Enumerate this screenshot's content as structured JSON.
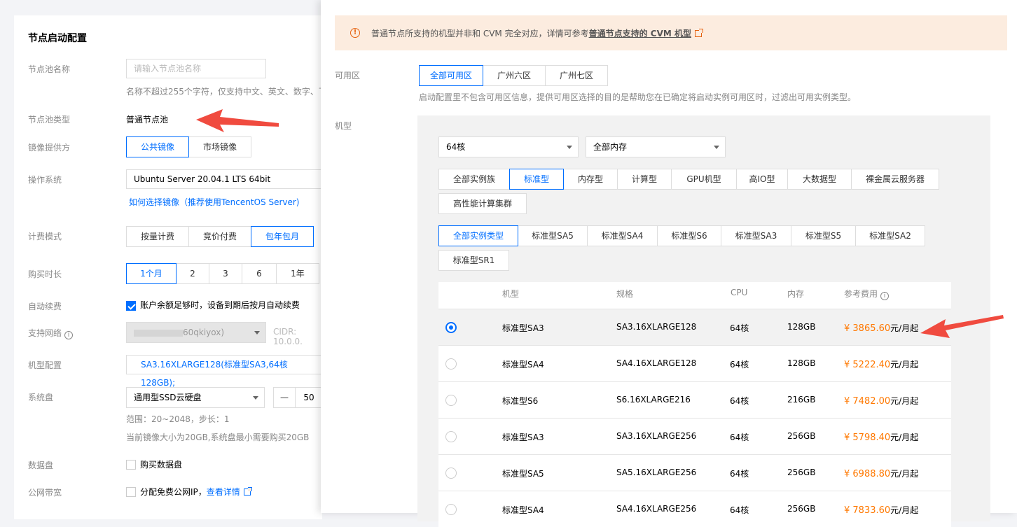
{
  "left": {
    "title": "节点启动配置",
    "pool_name": {
      "label": "节点池名称",
      "placeholder": "请输入节点池名称",
      "hint": "名称不超过255个字符，仅支持中文、英文、数字、下"
    },
    "pool_type": {
      "label": "节点池类型",
      "value": "普通节点池"
    },
    "image_provider": {
      "label": "镜像提供方",
      "options": [
        "公共镜像",
        "市场镜像"
      ]
    },
    "os": {
      "label": "操作系统",
      "value": "Ubuntu Server 20.04.1 LTS 64bit",
      "link": "如何选择镜像（推荐使用TencentOS Server)"
    },
    "billing": {
      "label": "计费模式",
      "options": [
        "按量计费",
        "竞价付费",
        "包年包月"
      ]
    },
    "duration": {
      "label": "购买时长",
      "options": [
        "1个月",
        "2",
        "3",
        "6",
        "1年"
      ]
    },
    "auto_renew": {
      "label": "自动续费",
      "text": "账户余额足够时，设备到期后按月自动续费"
    },
    "network": {
      "label": "支持网络",
      "value": "60qkiyox)",
      "cidr": "CIDR: 10.0.0."
    },
    "machine": {
      "label": "机型配置",
      "value": "SA3.16XLARGE128(标准型SA3,64核128GB);"
    },
    "system_disk": {
      "label": "系统盘",
      "value": "通用型SSD云硬盘",
      "minus": "—",
      "size": "50",
      "hint1": "范围：20~2048，步长：1",
      "hint2": "当前镜像大小为20GB,系统盘最小需要购买20GB"
    },
    "data_disk": {
      "label": "数据盘",
      "text": "购买数据盘"
    },
    "bandwidth": {
      "label": "公网带宽",
      "text": "分配免费公网IP，",
      "link": "查看详情"
    }
  },
  "right": {
    "alert": {
      "text": "普通节点所支持的机型并非和 CVM 完全对应，详情可参考",
      "link": "普通节点支持的 CVM 机型"
    },
    "zone": {
      "label": "可用区",
      "options": [
        "全部可用区",
        "广州六区",
        "广州七区"
      ],
      "hint": "启动配置里不包含可用区信息，提供可用区选择的目的是帮助您在已确定将启动实例可用区时，过滤出可用实例类型。"
    },
    "type_label": "机型",
    "cpu_select": "64核",
    "mem_select": "全部内存",
    "families": [
      "全部实例族",
      "标准型",
      "内存型",
      "计算型",
      "GPU机型",
      "高IO型",
      "大数据型",
      "裸金属云服务器",
      "高性能计算集群"
    ],
    "types": [
      "全部实例类型",
      "标准型SA5",
      "标准型SA4",
      "标准型S6",
      "标准型SA3",
      "标准型S5",
      "标准型SA2",
      "标准型SR1"
    ],
    "table": {
      "headers": [
        "机型",
        "规格",
        "CPU",
        "内存",
        "参考费用"
      ],
      "rows": [
        {
          "name": "标准型SA3",
          "spec": "SA3.16XLARGE128",
          "cpu": "64核",
          "mem": "128GB",
          "price": "¥ 3865.60",
          "unit": "元/月起"
        },
        {
          "name": "标准型SA4",
          "spec": "SA4.16XLARGE128",
          "cpu": "64核",
          "mem": "128GB",
          "price": "¥ 5222.40",
          "unit": "元/月起"
        },
        {
          "name": "标准型S6",
          "spec": "S6.16XLARGE216",
          "cpu": "64核",
          "mem": "216GB",
          "price": "¥ 7482.00",
          "unit": "元/月起"
        },
        {
          "name": "标准型SA3",
          "spec": "SA3.16XLARGE256",
          "cpu": "64核",
          "mem": "256GB",
          "price": "¥ 5798.40",
          "unit": "元/月起"
        },
        {
          "name": "标准型SA5",
          "spec": "SA5.16XLARGE256",
          "cpu": "64核",
          "mem": "256GB",
          "price": "¥ 6988.80",
          "unit": "元/月起"
        },
        {
          "name": "标准型SA4",
          "spec": "SA4.16XLARGE256",
          "cpu": "64核",
          "mem": "256GB",
          "price": "¥ 7833.60",
          "unit": "元/月起"
        }
      ]
    }
  },
  "colors": {
    "accent": "#006eff",
    "price": "#ff7800",
    "arrow": "#f04b3f",
    "alert_bg": "#fcecdf"
  }
}
